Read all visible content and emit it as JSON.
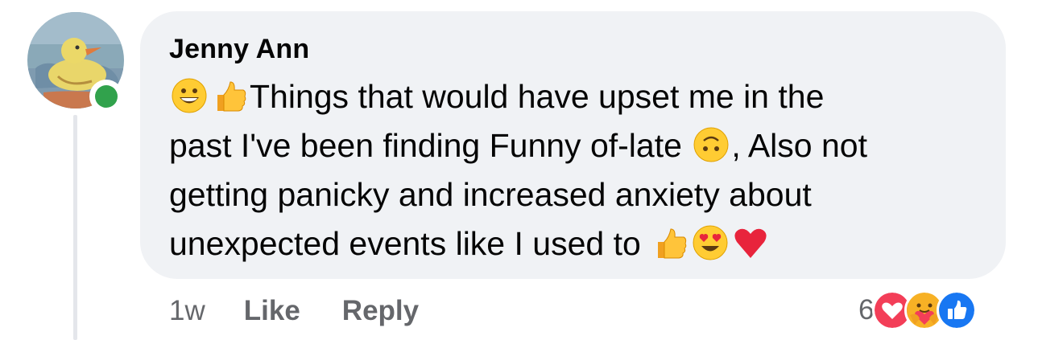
{
  "comment": {
    "author": "Jenny Ann",
    "avatar_icon": "duck-painting-avatar",
    "online": true,
    "line1": "Things that would have upset me in the",
    "line2a": "past I've been finding Funny of-late",
    "line2b": ",  Also not",
    "line3": "getting panicky and increased anxiety about",
    "line4": "unexpected events like I used to",
    "emojis": [
      "grinning-face",
      "thumbs-up",
      "upside-down-face",
      "thumbs-up",
      "heart-eyes-face",
      "red-heart"
    ]
  },
  "actions": {
    "time": "1w",
    "like_label": "Like",
    "reply_label": "Reply"
  },
  "reactions": {
    "count": "6",
    "icons": [
      "love-reaction-icon",
      "care-reaction-icon",
      "like-reaction-icon"
    ],
    "colors": {
      "love": "#f33e58",
      "like": "#1877f2",
      "care": "#f7b125"
    }
  },
  "colors": {
    "bubble": "#f0f2f5",
    "online": "#31a24c",
    "meta_text": "#65676b"
  }
}
